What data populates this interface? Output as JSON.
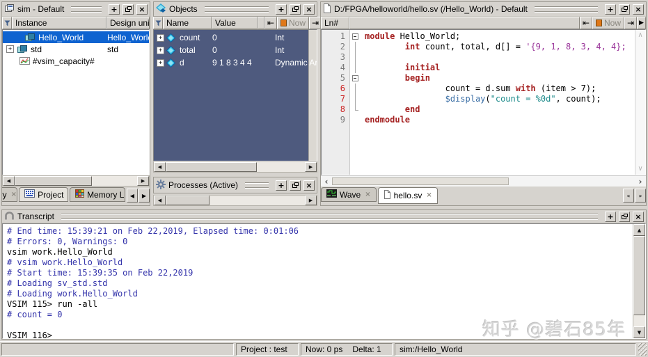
{
  "colors": {
    "selection_blue": "#0e63d0",
    "objects_bg": "#4e5a7e",
    "transcript_blue": "#3434ab",
    "keyword_red": "#a52121",
    "line_number_red": "#cc2222",
    "system_task_blue": "#3a6ea5",
    "string_teal": "#1b8a8a",
    "number_purple": "#993399",
    "now_orange": "#e07818",
    "chrome_gray": "#d6d3ce"
  },
  "glyphs": {
    "add": "+",
    "close": "×",
    "expand": "+",
    "arrow_left": "◀",
    "arrow_right": "▶",
    "arrow_up": "▲",
    "arrow_down": "▼",
    "chevron_left": "‹",
    "chevron_right": "›",
    "chevron_up": "∧",
    "chevron_down": "∨",
    "tab_prev": "«",
    "tab_next": "»",
    "now_left": "⇤",
    "now_right": "⇥"
  },
  "sim_panel": {
    "title": "sim - Default",
    "columns": [
      "Instance",
      "Design unit"
    ],
    "rows": [
      {
        "instance": "Hello_World",
        "design_unit": "Hello_World",
        "icon": "module-icon",
        "selected": true,
        "expander": false,
        "pad": 32
      },
      {
        "instance": "std",
        "design_unit": "std",
        "icon": "module-icon",
        "selected": false,
        "expander": true,
        "pad": 5
      },
      {
        "instance": "#vsim_capacity#",
        "design_unit": "",
        "icon": "capacity-icon",
        "selected": false,
        "expander": false,
        "pad": 24
      }
    ]
  },
  "objects_panel": {
    "title": "Objects",
    "columns": [
      "Name",
      "Value"
    ],
    "now_label": "Now",
    "rows": [
      {
        "name": "count",
        "value": "0",
        "kind": "Int"
      },
      {
        "name": "total",
        "value": "0",
        "kind": "Int"
      },
      {
        "name": "d",
        "value": "9 1 8 3 4 4",
        "kind": "Dynamic Arra"
      }
    ]
  },
  "processes_panel": {
    "title": "Processes (Active)"
  },
  "editor_panel": {
    "title": "D:/FPGA/helloworld/hello.sv (/Hello_World) - Default",
    "ln_header": "Ln#",
    "now_label": "Now",
    "code_lines": [
      {
        "num": "1",
        "red": false,
        "fold": "open",
        "segments": [
          {
            "c": "kw",
            "t": "module"
          },
          {
            "c": "pl",
            "t": " Hello_World;"
          }
        ]
      },
      {
        "num": "2",
        "red": false,
        "fold": "line",
        "segments": [
          {
            "c": "pl",
            "t": "        "
          },
          {
            "c": "kw",
            "t": "int"
          },
          {
            "c": "pl",
            "t": " count, total, d[] = "
          },
          {
            "c": "num",
            "t": "'{9, 1, 8, 3, 4, 4};"
          }
        ]
      },
      {
        "num": "3",
        "red": false,
        "fold": "line",
        "segments": []
      },
      {
        "num": "4",
        "red": false,
        "fold": "line",
        "segments": [
          {
            "c": "pl",
            "t": "        "
          },
          {
            "c": "kw",
            "t": "initial"
          }
        ]
      },
      {
        "num": "5",
        "red": false,
        "fold": "open",
        "segments": [
          {
            "c": "pl",
            "t": "        "
          },
          {
            "c": "kw",
            "t": "begin"
          }
        ]
      },
      {
        "num": "6",
        "red": true,
        "fold": "line",
        "segments": [
          {
            "c": "pl",
            "t": "                count = d.sum "
          },
          {
            "c": "kw",
            "t": "with"
          },
          {
            "c": "pl",
            "t": " (item > 7);"
          }
        ]
      },
      {
        "num": "7",
        "red": true,
        "fold": "line",
        "segments": [
          {
            "c": "pl",
            "t": "                "
          },
          {
            "c": "sys",
            "t": "$display"
          },
          {
            "c": "pl",
            "t": "("
          },
          {
            "c": "str",
            "t": "\"count = %0d\""
          },
          {
            "c": "pl",
            "t": ", count);"
          }
        ]
      },
      {
        "num": "8",
        "red": true,
        "fold": "corner",
        "segments": [
          {
            "c": "pl",
            "t": "        "
          },
          {
            "c": "kw",
            "t": "end"
          }
        ]
      },
      {
        "num": "9",
        "red": false,
        "fold": "none",
        "segments": [
          {
            "c": "kw",
            "t": "endmodule"
          }
        ]
      }
    ]
  },
  "left_tabs": {
    "items": [
      {
        "label": "ary",
        "closable": true
      },
      {
        "label": "Project",
        "closable": true,
        "icon": "project-icon"
      },
      {
        "label": "Memory List",
        "closable": false,
        "icon": "memory-list-icon"
      }
    ]
  },
  "right_tabs": {
    "items": [
      {
        "label": "Wave",
        "icon": "wave-icon",
        "active": false,
        "closable": true
      },
      {
        "label": "hello.sv",
        "icon": "file-icon",
        "active": true,
        "closable": true
      }
    ]
  },
  "transcript_panel": {
    "title": "Transcript",
    "lines": [
      {
        "c": "blue",
        "t": "# End time: 15:39:21 on Feb 22,2019, Elapsed time: 0:01:06"
      },
      {
        "c": "blue",
        "t": "# Errors: 0, Warnings: 0"
      },
      {
        "c": "black",
        "t": "vsim work.Hello_World"
      },
      {
        "c": "blue",
        "t": "# vsim work.Hello_World"
      },
      {
        "c": "blue",
        "t": "# Start time: 15:39:35 on Feb 22,2019"
      },
      {
        "c": "blue",
        "t": "# Loading sv_std.std"
      },
      {
        "c": "blue",
        "t": "# Loading work.Hello_World"
      },
      {
        "c": "black",
        "t": "VSIM 115> run -all"
      },
      {
        "c": "blue",
        "t": "# count = 0"
      },
      {
        "c": "black",
        "t": ""
      },
      {
        "c": "black",
        "t": "VSIM 116>"
      }
    ]
  },
  "status_bar": {
    "project": "Project : test",
    "now": "Now: 0 ps",
    "delta": "Delta: 1",
    "context": "sim:/Hello_World"
  },
  "watermark": "知乎 @碧石85年"
}
